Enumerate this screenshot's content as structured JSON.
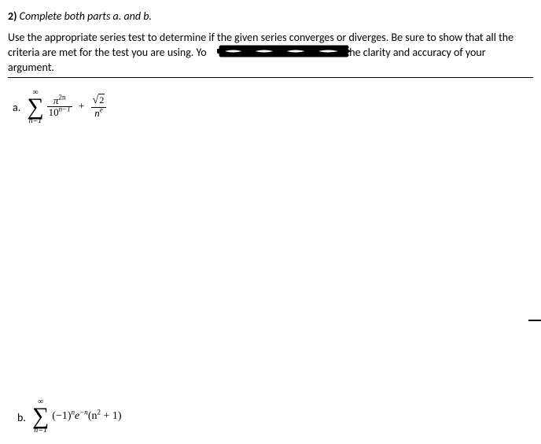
{
  "header": {
    "number": "2)",
    "directive": "Complete both parts a. and b."
  },
  "instructions": {
    "line1": "Use the appropriate series test to determine if the given series converges or diverges. Be sure to show that all the",
    "line2_pre": "criteria are met for the test you are using. Yo",
    "line2_post": "n the clarity and accuracy of your argument."
  },
  "partA": {
    "label": "a.",
    "sigma_upper": "∞",
    "sigma_lower": "n=1",
    "term1_num_base": "π",
    "term1_num_exp": "2n",
    "term1_den_base": "10",
    "term1_den_exp": "n−1",
    "plus": "+",
    "term2_num_rad": "2",
    "term2_den_base": "n",
    "term2_den_exp": "e"
  },
  "partB": {
    "label": "b.",
    "sigma_upper": "∞",
    "sigma_lower": "n=1",
    "expr_open": "(−1)",
    "expr_sup1": "n",
    "expr_e": "e",
    "expr_sup2": "−n",
    "expr_tail": "(n",
    "expr_sup3": "2",
    "expr_close": " + 1)"
  }
}
